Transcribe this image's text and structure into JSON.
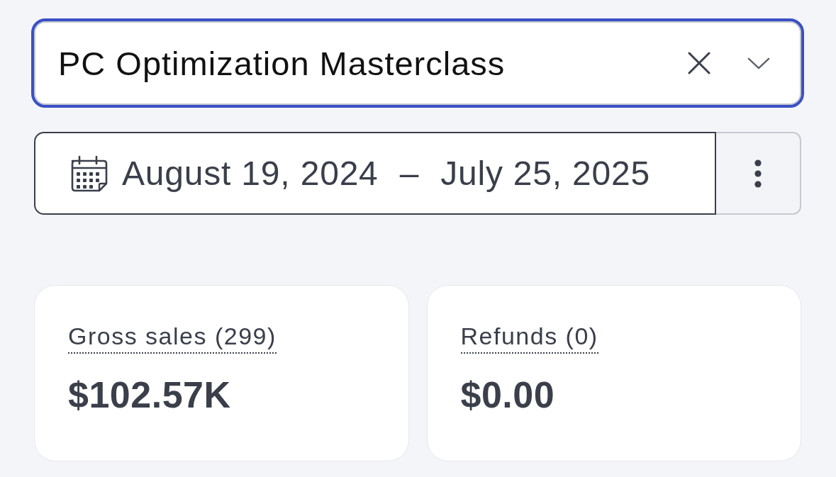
{
  "product_select": {
    "value": "PC Optimization Masterclass",
    "focused": true
  },
  "date_range": {
    "start": "August 19, 2024",
    "separator": "–",
    "end": "July 25, 2025"
  },
  "metrics": [
    {
      "label": "Gross sales (299)",
      "value": "$102.57K"
    },
    {
      "label": "Refunds (0)",
      "value": "$0.00"
    }
  ]
}
